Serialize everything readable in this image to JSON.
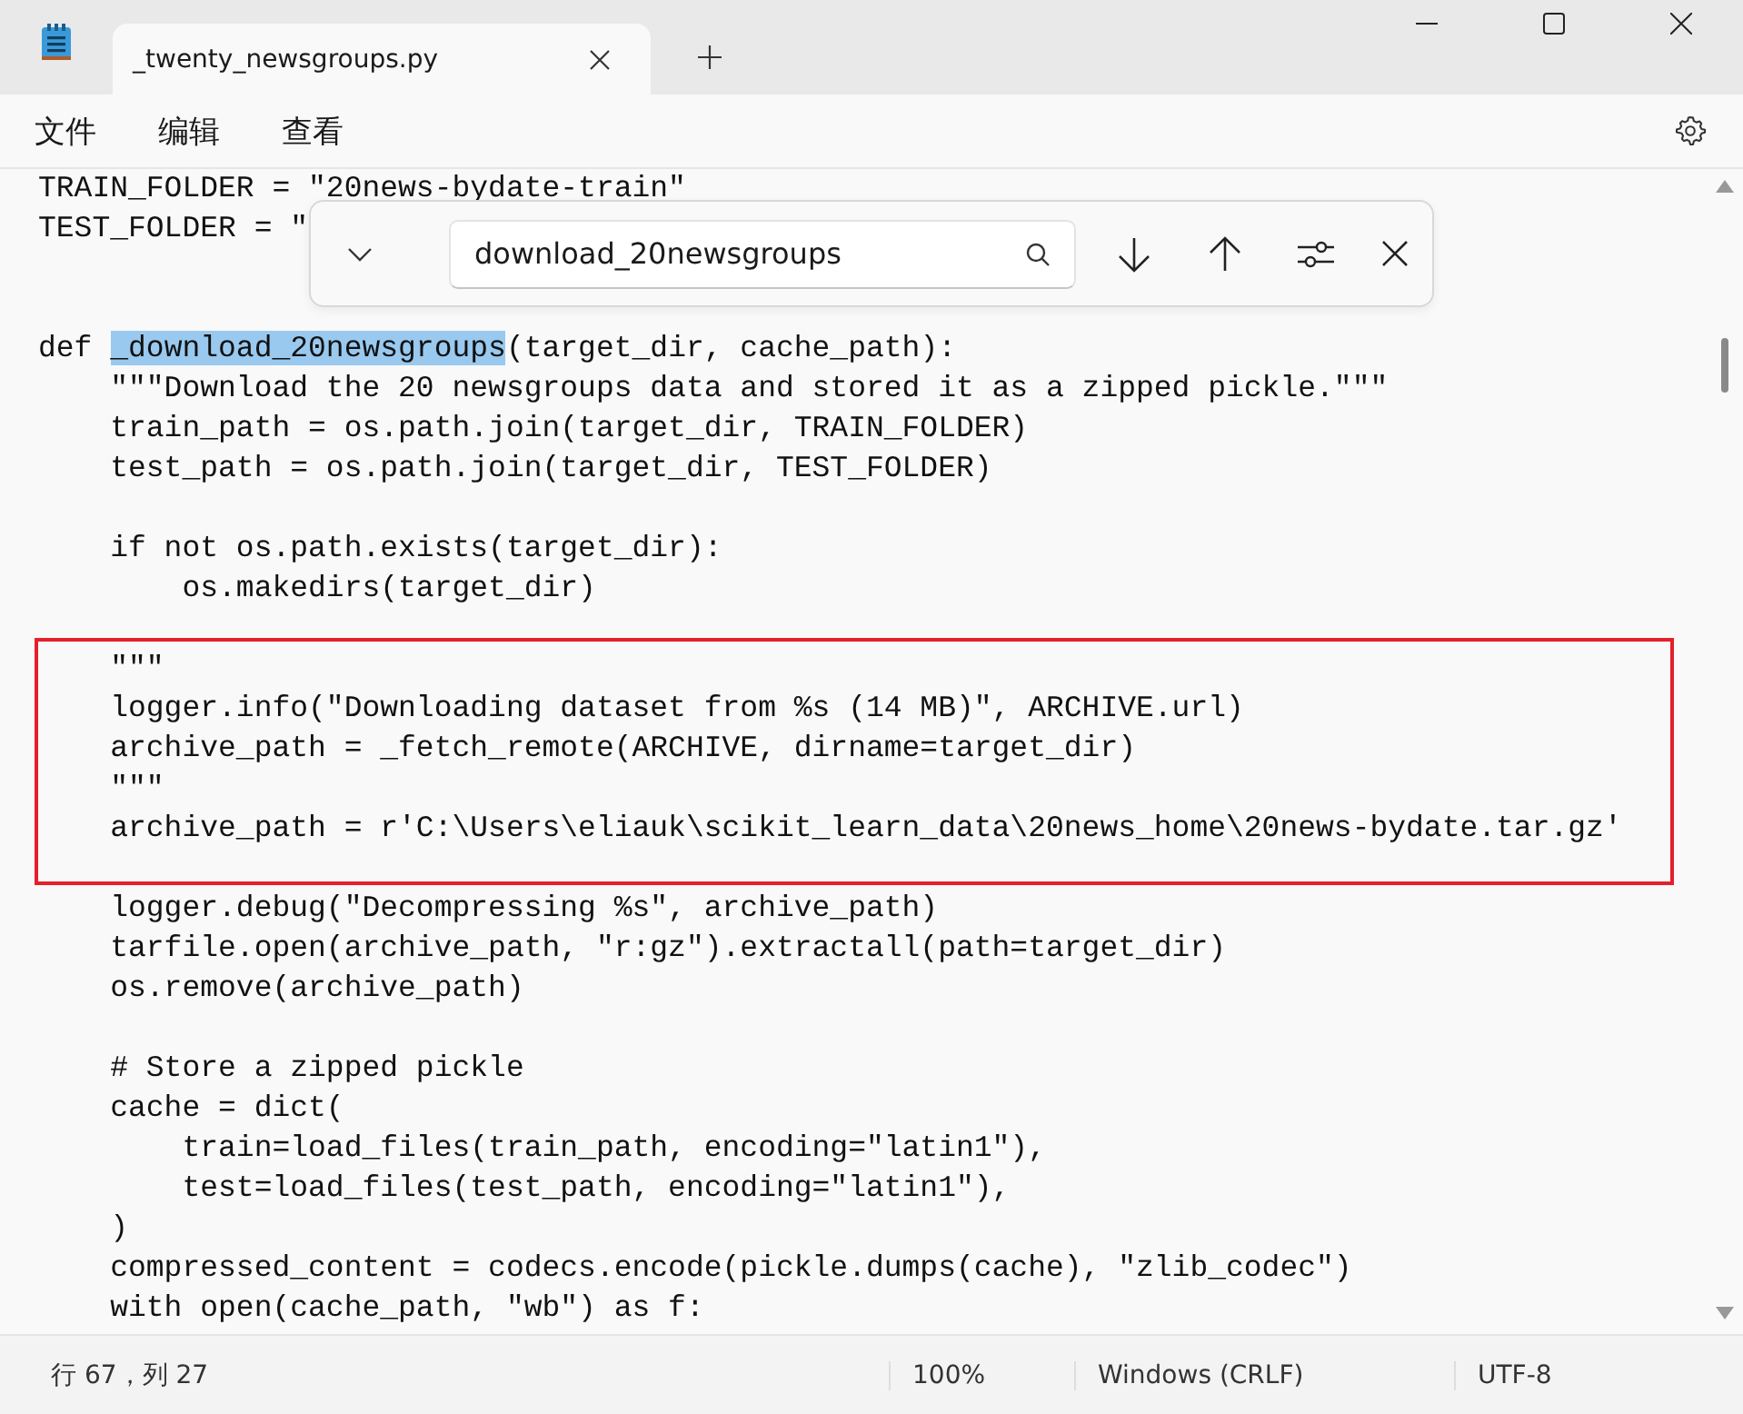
{
  "window": {
    "tab": {
      "title": "_twenty_newsgroups.py",
      "selected": true
    }
  },
  "menu": [
    {
      "label": "文件"
    },
    {
      "label": "编辑"
    },
    {
      "label": "查看"
    }
  ],
  "find_bar": {
    "value": "download_20newsgroups"
  },
  "code": [
    {
      "boxed": false,
      "lines": [
        {
          "kind": "text",
          "text": "TRAIN_FOLDER = \"20news-bydate-train\""
        },
        {
          "kind": "text",
          "text": "TEST_FOLDER = \""
        },
        {
          "kind": "blank"
        },
        {
          "kind": "blank"
        },
        {
          "kind": "text",
          "segments": [
            {
              "text": "def ",
              "selected": false
            },
            {
              "text": "_download_20newsgroups",
              "selected": true
            },
            {
              "text": "(target_dir, cache_path):",
              "selected": false
            }
          ]
        },
        {
          "kind": "text",
          "text": "    \"\"\"Download the 20 newsgroups data and stored it as a zipped pickle.\"\"\""
        },
        {
          "kind": "text",
          "text": "    train_path = os.path.join(target_dir, TRAIN_FOLDER)"
        },
        {
          "kind": "text",
          "text": "    test_path = os.path.join(target_dir, TEST_FOLDER)"
        },
        {
          "kind": "blank"
        },
        {
          "kind": "text",
          "text": "    if not os.path.exists(target_dir):"
        },
        {
          "kind": "text",
          "text": "        os.makedirs(target_dir)"
        },
        {
          "kind": "blank"
        }
      ]
    },
    {
      "boxed": true,
      "lines": [
        {
          "kind": "text",
          "text": "    \"\"\""
        },
        {
          "kind": "text",
          "text": "    logger.info(\"Downloading dataset from %s (14 MB)\", ARCHIVE.url)"
        },
        {
          "kind": "text",
          "text": "    archive_path = _fetch_remote(ARCHIVE, dirname=target_dir)"
        },
        {
          "kind": "text",
          "text": "    \"\"\""
        },
        {
          "kind": "text",
          "text": "    archive_path = r'C:\\Users\\eliauk\\scikit_learn_data\\20news_home\\20news-bydate.tar.gz'"
        }
      ]
    },
    {
      "boxed": false,
      "lines": [
        {
          "kind": "blank"
        },
        {
          "kind": "text",
          "text": "    logger.debug(\"Decompressing %s\", archive_path)"
        },
        {
          "kind": "text",
          "text": "    tarfile.open(archive_path, \"r:gz\").extractall(path=target_dir)"
        },
        {
          "kind": "text",
          "text": "    os.remove(archive_path)"
        },
        {
          "kind": "blank"
        },
        {
          "kind": "text",
          "text": "    # Store a zipped pickle"
        },
        {
          "kind": "text",
          "text": "    cache = dict("
        },
        {
          "kind": "text",
          "text": "        train=load_files(train_path, encoding=\"latin1\"),"
        },
        {
          "kind": "text",
          "text": "        test=load_files(test_path, encoding=\"latin1\"),"
        },
        {
          "kind": "text",
          "text": "    )"
        },
        {
          "kind": "text",
          "text": "    compressed_content = codecs.encode(pickle.dumps(cache), \"zlib_codec\")"
        },
        {
          "kind": "text",
          "text": "    with open(cache_path, \"wb\") as f:"
        }
      ]
    }
  ],
  "status_bar": {
    "position": "行 67，列 27",
    "zoom": "100%",
    "line_ending": "Windows (CRLF)",
    "encoding": "UTF-8"
  }
}
